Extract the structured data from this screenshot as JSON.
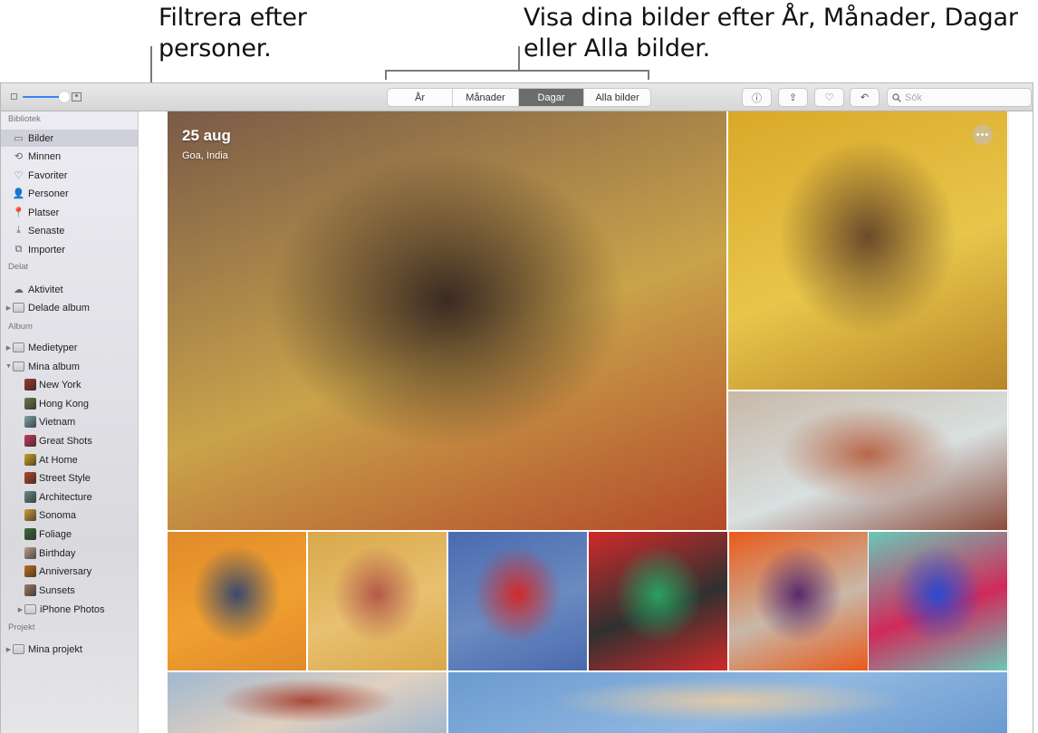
{
  "callouts": {
    "left": "Filtrera efter personer.",
    "right": "Visa dina bilder efter År, Månader, Dagar eller Alla bilder."
  },
  "toolbar": {
    "zoom_slider_value": 0.9,
    "view_tabs": [
      {
        "label": "År",
        "active": false
      },
      {
        "label": "Månader",
        "active": false
      },
      {
        "label": "Dagar",
        "active": true
      },
      {
        "label": "Alla bilder",
        "active": false
      }
    ],
    "info_icon": "ⓘ",
    "share_icon": "⇪",
    "favorite_icon": "♡",
    "rotate_icon": "↶",
    "search_placeholder": "Sök",
    "search_value": ""
  },
  "sidebar": {
    "sections": [
      {
        "header": "Bibliotek",
        "items": [
          {
            "label": "Bilder",
            "icon": "photos-icon",
            "glyph": "▭",
            "selected": true
          },
          {
            "label": "Minnen",
            "icon": "memories-icon",
            "glyph": "⟲"
          },
          {
            "label": "Favoriter",
            "icon": "heart-icon",
            "glyph": "♡"
          },
          {
            "label": "Personer",
            "icon": "person-icon",
            "glyph": "👤"
          },
          {
            "label": "Platser",
            "icon": "pin-icon",
            "glyph": "📍"
          },
          {
            "label": "Senaste",
            "icon": "import-icon",
            "glyph": "⤓"
          },
          {
            "label": "Importer",
            "icon": "camera-icon",
            "glyph": "⧉"
          }
        ]
      },
      {
        "header": "Delat",
        "items": [
          {
            "label": "Aktivitet",
            "icon": "cloud-icon",
            "glyph": "☁"
          },
          {
            "label": "Delade album",
            "icon": "folder-icon",
            "disclosure": "▶"
          }
        ]
      },
      {
        "header": "Album",
        "items": [
          {
            "label": "Medietyper",
            "icon": "folder-icon",
            "disclosure": "▶"
          },
          {
            "label": "Mina album",
            "icon": "folder-icon",
            "disclosure": "▼"
          },
          {
            "label": "New York",
            "thumb": "#9b3a2f",
            "indent": 1
          },
          {
            "label": "Hong Kong",
            "thumb": "#6b7a4a",
            "indent": 1
          },
          {
            "label": "Vietnam",
            "thumb": "#7fa3a8",
            "indent": 1
          },
          {
            "label": "Great Shots",
            "thumb": "#c23d5a",
            "indent": 1
          },
          {
            "label": "At Home",
            "thumb": "#c8a421",
            "indent": 1
          },
          {
            "label": "Street Style",
            "thumb": "#b14a2a",
            "indent": 1
          },
          {
            "label": "Architecture",
            "thumb": "#6b8a88",
            "indent": 1
          },
          {
            "label": "Sonoma",
            "thumb": "#d19a3a",
            "indent": 1
          },
          {
            "label": "Foliage",
            "thumb": "#3f6b3a",
            "indent": 1
          },
          {
            "label": "Birthday",
            "thumb": "#b8a090",
            "indent": 1
          },
          {
            "label": "Anniversary",
            "thumb": "#c07020",
            "indent": 1
          },
          {
            "label": "Sunsets",
            "thumb": "#a07a6a",
            "indent": 1
          },
          {
            "label": "iPhone Photos",
            "icon": "folder-icon",
            "disclosure": "▶",
            "indent": 1
          }
        ]
      },
      {
        "header": "Projekt",
        "items": [
          {
            "label": "Mina projekt",
            "icon": "folder-icon",
            "disclosure": "▶"
          }
        ]
      }
    ]
  },
  "moment": {
    "date": "25 aug",
    "location": "Goa, India",
    "more_label": "•••"
  },
  "photos": [
    {
      "name": "photo-woman-striped-dress",
      "colors": [
        "#7a5a48",
        "#3a2a22",
        "#c9a34a",
        "#b34a2a"
      ]
    },
    {
      "name": "photo-man-yellow-shirt",
      "colors": [
        "#d9a82a",
        "#6b4a2a",
        "#e8c64a",
        "#b8862a"
      ]
    },
    {
      "name": "photo-woman-red-dress-courtyard",
      "colors": [
        "#c8b8a8",
        "#b8684a",
        "#d8e0e0",
        "#8a4a3a"
      ]
    },
    {
      "name": "photo-woman-orange-scarf",
      "colors": [
        "#e08a2a",
        "#3a4a6a",
        "#f0a030"
      ]
    },
    {
      "name": "photo-dancer-yellow-wall",
      "colors": [
        "#d9a84a",
        "#b45a4a",
        "#e8c070"
      ]
    },
    {
      "name": "photo-red-veil-blue-wall",
      "colors": [
        "#4a6ab0",
        "#d02a2a",
        "#6a8ac0"
      ]
    },
    {
      "name": "photo-striped-fabric-hand",
      "colors": [
        "#d02a2a",
        "#2aa060",
        "#303030"
      ]
    },
    {
      "name": "photo-feet-orange-powder",
      "colors": [
        "#e85a1a",
        "#5a2a6a",
        "#c8b8a8"
      ]
    },
    {
      "name": "photo-laundry-line",
      "colors": [
        "#6ac8b8",
        "#2a4ad0",
        "#d02a5a"
      ]
    },
    {
      "name": "photo-mosque-facade",
      "colors": [
        "#a0b8d0",
        "#a84a3a",
        "#e0d0c0"
      ]
    },
    {
      "name": "photo-sky-sand",
      "colors": [
        "#6a9ad0",
        "#e0c8a8",
        "#90b8e0"
      ]
    }
  ]
}
